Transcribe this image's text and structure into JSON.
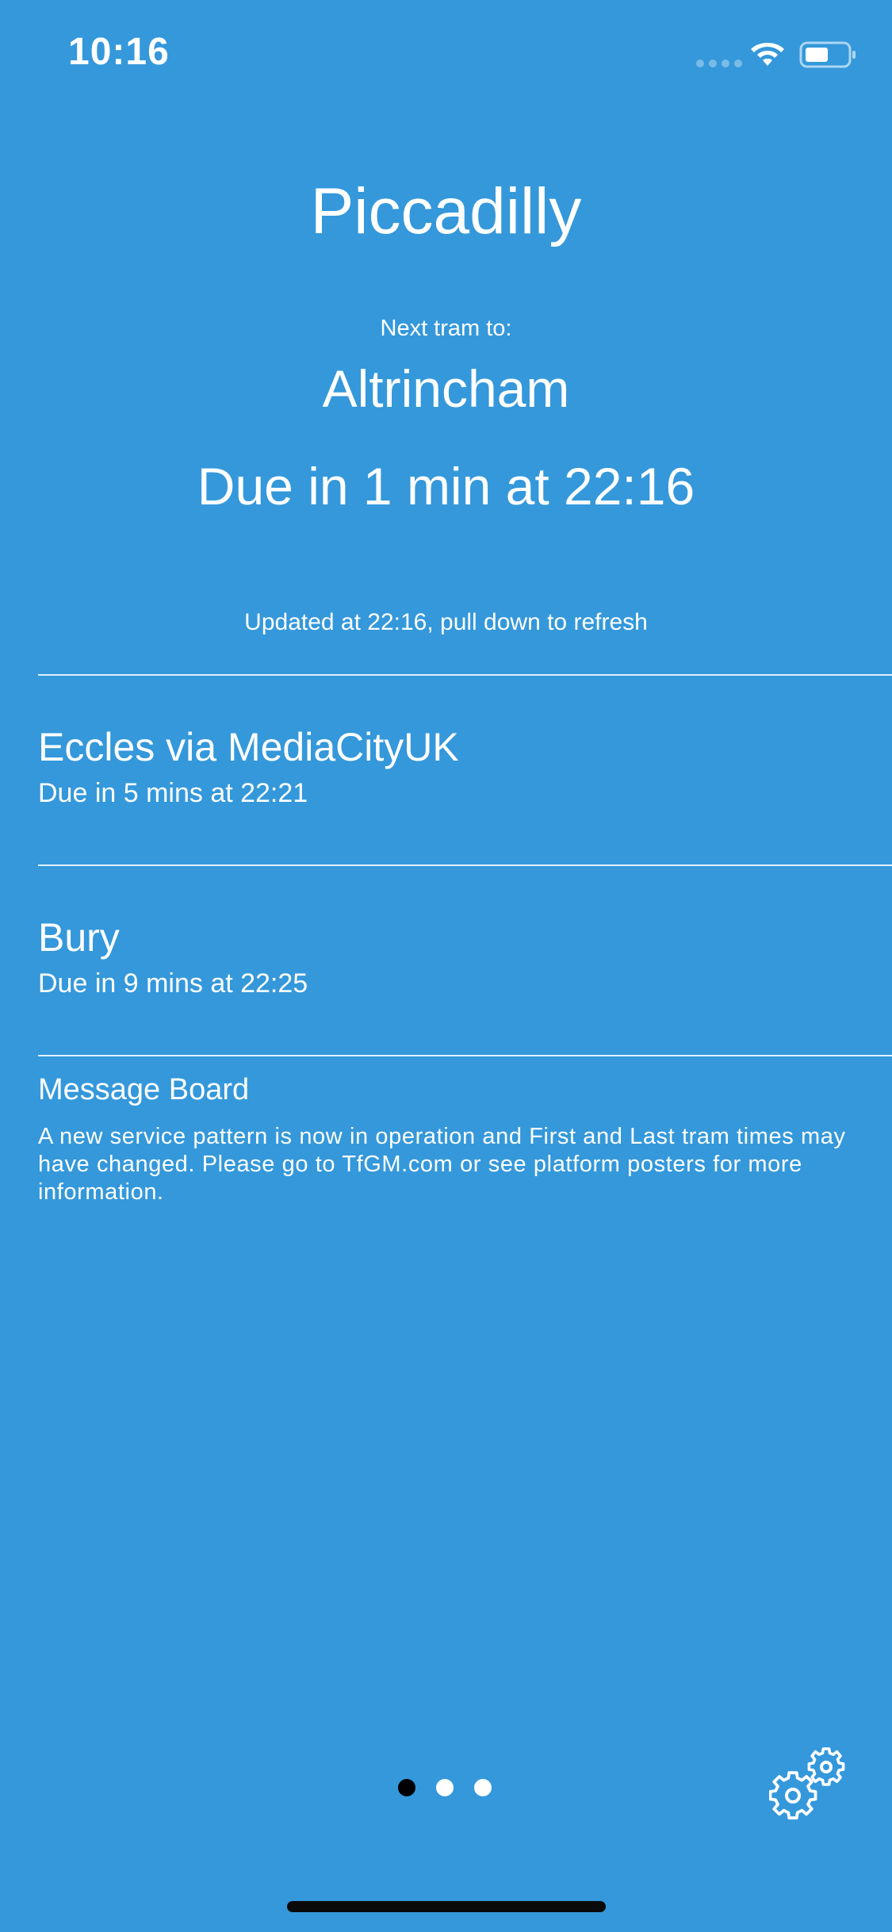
{
  "status_bar": {
    "time": "10:16"
  },
  "station": {
    "name": "Piccadilly"
  },
  "next_tram": {
    "label": "Next tram to:",
    "destination": "Altrincham",
    "due": "Due in 1 min at 22:16"
  },
  "updated_text": "Updated at 22:16, pull down to refresh",
  "trams": [
    {
      "destination": "Eccles via MediaCityUK",
      "due": "Due in 5 mins at 22:21"
    },
    {
      "destination": "Bury",
      "due": "Due in 9 mins at 22:25"
    }
  ],
  "message_board": {
    "title": "Message Board",
    "text": "A new service pattern is now in operation and First and Last tram times may have changed. Please go to TfGM.com or see platform posters for more information."
  },
  "pagination": {
    "pages": 3,
    "current": 1
  },
  "icons": {
    "wifi": "wifi-icon",
    "battery": "battery-icon",
    "settings": "gear-icon"
  },
  "colors": {
    "background": "#3498db",
    "text": "#ffffff",
    "active_dot": "#000000"
  }
}
